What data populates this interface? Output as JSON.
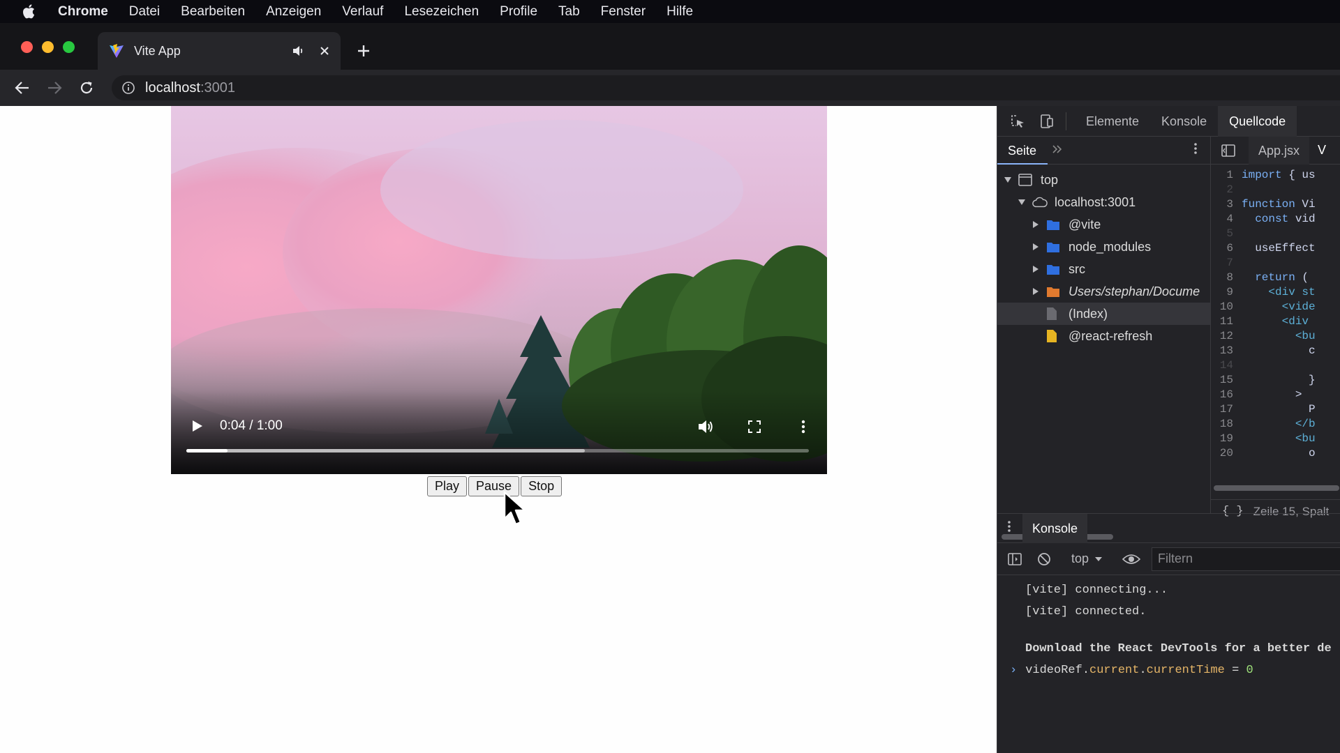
{
  "menubar": {
    "app": "Chrome",
    "items": [
      "Datei",
      "Bearbeiten",
      "Anzeigen",
      "Verlauf",
      "Lesezeichen",
      "Profile",
      "Tab",
      "Fenster",
      "Hilfe"
    ]
  },
  "browser": {
    "tab_title": "Vite App",
    "url_host": "localhost",
    "url_port": ":3001"
  },
  "video": {
    "time": "0:04 / 1:00",
    "progress_fraction": 0.0667,
    "buffered_fraction": 0.64
  },
  "buttons": {
    "play": "Play",
    "pause": "Pause",
    "stop": "Stop"
  },
  "devtools": {
    "tabs": [
      "Elemente",
      "Konsole",
      "Quellcode"
    ],
    "active_tab": "Quellcode",
    "navigator": {
      "header": "Seite",
      "tree": [
        {
          "label": "top",
          "depth": 0,
          "expanded": true,
          "icon": "frame-icon"
        },
        {
          "label": "localhost:3001",
          "depth": 1,
          "expanded": true,
          "icon": "cloud-icon"
        },
        {
          "label": "@vite",
          "depth": 2,
          "expanded": false,
          "icon": "folder-icon"
        },
        {
          "label": "node_modules",
          "depth": 2,
          "expanded": false,
          "icon": "folder-icon"
        },
        {
          "label": "src",
          "depth": 2,
          "expanded": false,
          "icon": "folder-icon"
        },
        {
          "label": "Users/stephan/Docume",
          "depth": 2,
          "expanded": false,
          "icon": "folder-orange-icon",
          "italic": true
        },
        {
          "label": "(Index)",
          "depth": 2,
          "icon": "file-icon",
          "selected": true
        },
        {
          "label": "@react-refresh",
          "depth": 2,
          "icon": "file-yellow-icon"
        }
      ]
    },
    "editor": {
      "file_tab": "App.jsx",
      "file_tab_2": "V",
      "lines": [
        {
          "n": "1",
          "text": "import { us"
        },
        {
          "n": "2",
          "text": ""
        },
        {
          "n": "3",
          "text": "function Vi"
        },
        {
          "n": "4",
          "text": "  const vid"
        },
        {
          "n": "5",
          "text": ""
        },
        {
          "n": "6",
          "text": "  useEffect"
        },
        {
          "n": "7",
          "text": ""
        },
        {
          "n": "8",
          "text": "  return ("
        },
        {
          "n": "9",
          "text": "    <div st"
        },
        {
          "n": "10",
          "text": "      <vide"
        },
        {
          "n": "11",
          "text": "      <div"
        },
        {
          "n": "12",
          "text": "        <bu"
        },
        {
          "n": "13",
          "text": "          c"
        },
        {
          "n": "14",
          "text": ""
        },
        {
          "n": "15",
          "text": "          }"
        },
        {
          "n": "16",
          "text": "        >"
        },
        {
          "n": "17",
          "text": "          P"
        },
        {
          "n": "18",
          "text": "        </b"
        },
        {
          "n": "19",
          "text": "        <bu"
        },
        {
          "n": "20",
          "text": "          o"
        }
      ],
      "status": "Zeile 15, Spalt"
    },
    "console": {
      "tab": "Konsole",
      "context": "top",
      "filter_placeholder": "Filtern",
      "messages": [
        "[vite] connecting...",
        "[vite] connected.",
        "Download the React DevTools for a better de"
      ],
      "input_obj": "videoRef.",
      "input_prop1": "current",
      "input_dot": ".",
      "input_prop2": "currentTime",
      "input_op": " = ",
      "input_val": "0"
    }
  }
}
